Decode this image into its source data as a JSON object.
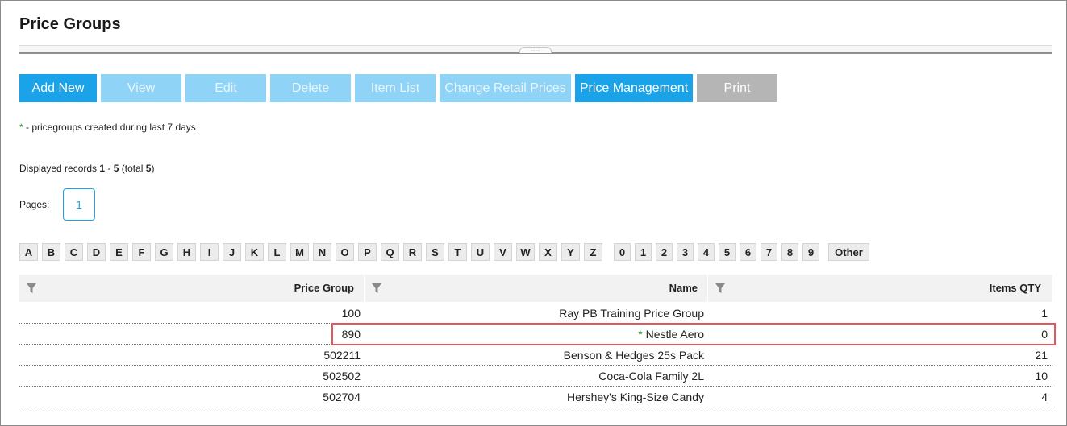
{
  "page": {
    "title": "Price Groups"
  },
  "toolbar": {
    "add_new": "Add New",
    "view": "View",
    "edit": "Edit",
    "delete": "Delete",
    "item_list": "Item List",
    "change_retail_prices": "Change Retail Prices",
    "price_management": "Price Management",
    "print": "Print"
  },
  "note": {
    "star": "*",
    "text": " - pricegroups created during last 7 days"
  },
  "records": {
    "prefix": "Displayed records ",
    "from": "1",
    "dash": " - ",
    "to": "5",
    "total_prefix": " (total ",
    "total": "5",
    "total_suffix": ")"
  },
  "pages": {
    "label": "Pages:",
    "current": "1"
  },
  "alphabet": [
    "A",
    "B",
    "C",
    "D",
    "E",
    "F",
    "G",
    "H",
    "I",
    "J",
    "K",
    "L",
    "M",
    "N",
    "O",
    "P",
    "Q",
    "R",
    "S",
    "T",
    "U",
    "V",
    "W",
    "X",
    "Y",
    "Z"
  ],
  "digits": [
    "0",
    "1",
    "2",
    "3",
    "4",
    "5",
    "6",
    "7",
    "8",
    "9"
  ],
  "other": "Other",
  "grid": {
    "headers": {
      "price_group": "Price Group",
      "name": "Name",
      "items_qty": "Items QTY"
    },
    "rows": [
      {
        "price_group": "100",
        "star": "",
        "name": "Ray PB Training Price Group",
        "items_qty": "1"
      },
      {
        "price_group": "890",
        "star": "* ",
        "name": "Nestle Aero",
        "items_qty": "0"
      },
      {
        "price_group": "502211",
        "star": "",
        "name": "Benson & Hedges 25s Pack",
        "items_qty": "21"
      },
      {
        "price_group": "502502",
        "star": "",
        "name": "Coca-Cola Family 2L",
        "items_qty": "10"
      },
      {
        "price_group": "502704",
        "star": "",
        "name": "Hershey's King-Size Candy",
        "items_qty": "4"
      }
    ]
  },
  "colors": {
    "primary": "#1aa3e8",
    "disabled": "#8fd3f6",
    "print": "#b5b5b5",
    "highlight": "#e0595f",
    "new_star": "#2a9a2a"
  }
}
